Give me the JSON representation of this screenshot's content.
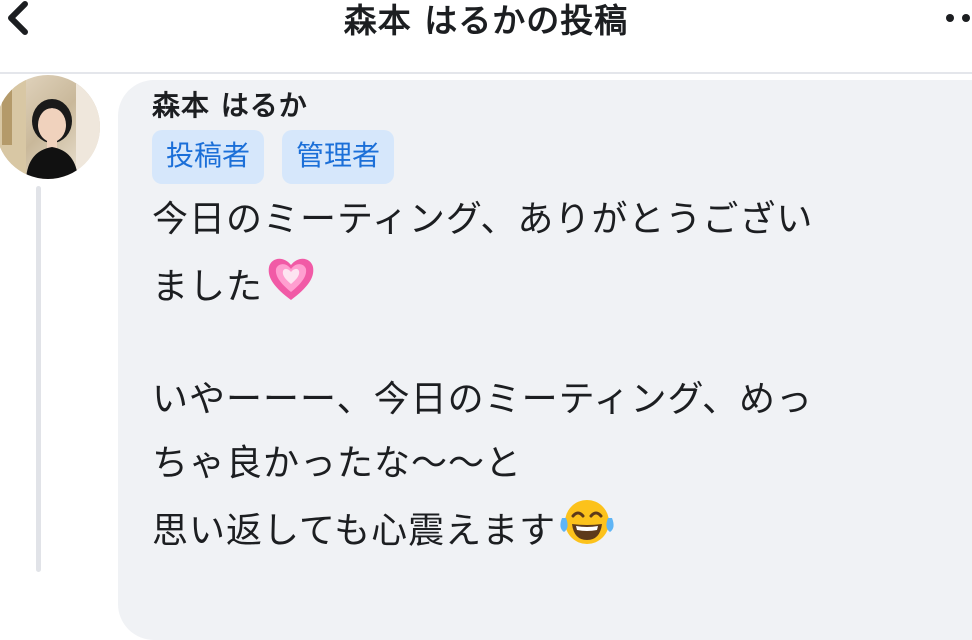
{
  "header": {
    "title": "森本 はるかの投稿",
    "back_icon": "chevron-left-icon",
    "more_icon": "more-horizontal-icon"
  },
  "post": {
    "author": "森本 はるか",
    "badges": [
      "投稿者",
      "管理者"
    ],
    "lines": [
      "今日のミーティング、ありがとうござい",
      "ました",
      "いやーーー、今日のミーティング、めっ",
      "ちゃ良かったな〜〜と",
      "思い返しても心震えます"
    ],
    "emoji": {
      "heart": "growing-heart-emoji",
      "laugh": "tears-of-joy-emoji"
    }
  },
  "colors": {
    "bubble_bg": "#f0f2f5",
    "badge_bg": "#d6e7fb",
    "badge_text": "#1b6fd8"
  }
}
